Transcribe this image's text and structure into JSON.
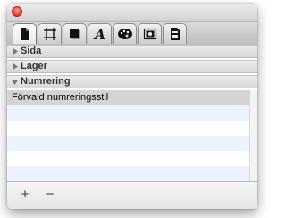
{
  "sections": [
    {
      "label": "Sida",
      "expanded": false
    },
    {
      "label": "Lager",
      "expanded": false
    },
    {
      "label": "Numrering",
      "expanded": true
    }
  ],
  "list": {
    "rows": [
      "Förvald numreringsstil",
      "",
      "",
      "",
      "",
      ""
    ],
    "selected_index": 0
  },
  "tabs": [
    {
      "name": "document",
      "icon": "document-icon"
    },
    {
      "name": "frame",
      "icon": "frame-icon"
    },
    {
      "name": "shadow",
      "icon": "shadow-box-icon"
    },
    {
      "name": "text",
      "icon": "font-a-icon"
    },
    {
      "name": "colors",
      "icon": "palette-icon"
    },
    {
      "name": "image",
      "icon": "image-icon"
    },
    {
      "name": "metrics",
      "icon": "metrics-icon"
    }
  ],
  "bottombar": {
    "add_label": "+",
    "remove_label": "−"
  },
  "colors": {
    "close": "#e4463b",
    "row_alt": "#edf3fe",
    "row_selected": "#d4d4d4"
  }
}
